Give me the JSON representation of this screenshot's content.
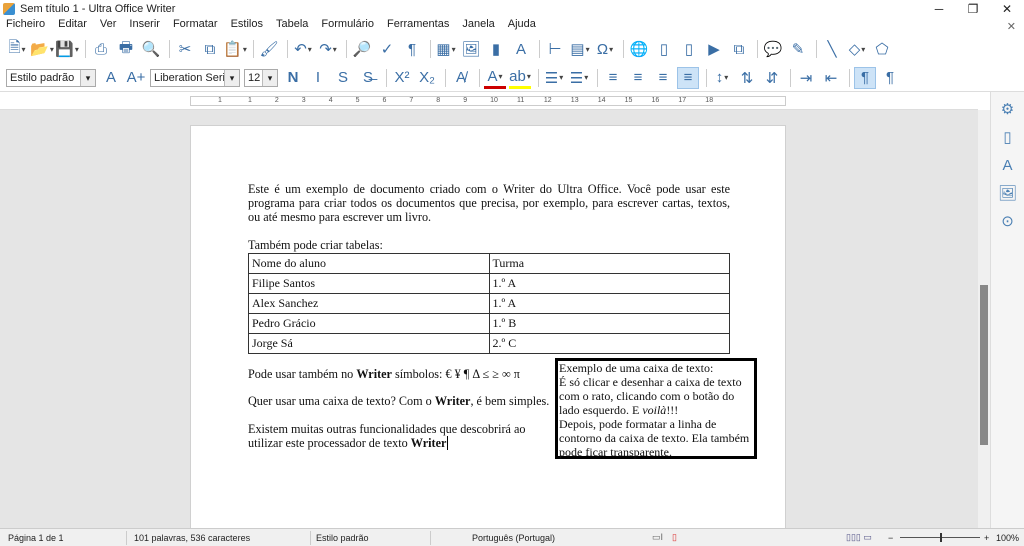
{
  "window": {
    "title": "Sem título 1 - Ultra Office Writer"
  },
  "menu": [
    "Ficheiro",
    "Editar",
    "Ver",
    "Inserir",
    "Formatar",
    "Estilos",
    "Tabela",
    "Formulário",
    "Ferramentas",
    "Janela",
    "Ajuda"
  ],
  "toolbar1": [
    "new-document-icon",
    "open-folder-icon",
    "save-icon",
    "|",
    "export-pdf-icon",
    "print-icon",
    "print-preview-icon",
    "|",
    "cut-icon",
    "copy-icon",
    "paste-icon",
    "|",
    "clone-formatting-icon",
    "|",
    "undo-icon",
    "redo-icon",
    "|",
    "find-replace-icon",
    "spellcheck-icon",
    "formatting-marks-icon",
    "|",
    "insert-table-icon",
    "insert-image-icon",
    "insert-chart-icon",
    "insert-textbox-icon",
    "|",
    "page-break-icon",
    "insert-field-icon",
    "special-character-icon",
    "|",
    "hyperlink-icon",
    "footnote-icon",
    "endnote-icon",
    "bookmark-icon",
    "cross-reference-icon",
    "|",
    "comment-icon",
    "track-changes-icon",
    "|",
    "line-icon",
    "basic-shapes-icon",
    "shapes-icon"
  ],
  "toolbar2": {
    "paragraph_style": "Estilo padrão",
    "font_name": "Liberation Serif",
    "font_size": "12",
    "icons": [
      "update-style-icon",
      "new-style-icon",
      "|",
      "bold-icon",
      "italic-icon",
      "underline-icon",
      "strikethrough-icon",
      "|",
      "superscript-icon",
      "subscript-icon",
      "|",
      "clear-formatting-icon",
      "|",
      "font-color-icon",
      "highlight-icon",
      "|",
      "bullet-list-icon",
      "numbered-list-icon",
      "|",
      "align-left-icon",
      "align-center-icon",
      "align-right-icon",
      "justify-icon",
      "|",
      "line-spacing-icon",
      "increase-paragraph-spacing-icon",
      "decrease-paragraph-spacing-icon",
      "|",
      "increase-indent-icon",
      "decrease-indent-icon",
      "|",
      "ltr-icon",
      "rtl-icon"
    ]
  },
  "ruler": [
    "1",
    "1",
    "2",
    "3",
    "4",
    "5",
    "6",
    "7",
    "8",
    "9",
    "10",
    "11",
    "12",
    "13",
    "14",
    "15",
    "16",
    "17",
    "18"
  ],
  "document": {
    "para1": "Este é um exemplo de documento criado com o Writer do Ultra Office. Você pode usar este programa para criar todos os documentos que precisa, por exemplo, para escrever cartas, textos, ou até mesmo para escrever um livro.",
    "para2": "Também pode criar tabelas:",
    "table": {
      "headers": [
        "Nome do aluno",
        "Turma"
      ],
      "rows": [
        [
          "Filipe Santos",
          "1.º A"
        ],
        [
          "Alex Sanchez",
          "1.º A"
        ],
        [
          "Pedro Grácio",
          "1.º B"
        ],
        [
          "Jorge Sá",
          "2.º C"
        ]
      ]
    },
    "para3_a": "Pode usar também no ",
    "para3_b": "Writer",
    "para3_c": " símbolos: € ¥ ¶ Δ ≤ ≥ ∞ π",
    "para4_a": "Quer usar uma caixa de texto? Com o ",
    "para4_b": "Writer",
    "para4_c": ", é bem simples.",
    "para5_a": "Existem muitas outras funcionalidades que descobrirá ao utilizar este processador de texto ",
    "para5_b": "Writer",
    "textbox": {
      "l1": "Exemplo de uma caixa de texto:",
      "l2": "É só clicar e desenhar a caixa de texto com o rato, clicando com o botão do lado esquerdo. E ",
      "l2_italic": "voilà",
      "l2_end": "!!!",
      "l3": "Depois, pode formatar a linha de contorno da caixa de texto. Ela também pode ficar transparente."
    }
  },
  "sidebar": [
    "properties-icon",
    "page-icon",
    "styles-icon",
    "gallery-icon",
    "navigator-icon"
  ],
  "status": {
    "page": "Página 1 de 1",
    "words": "101 palavras, 536 caracteres",
    "style": "Estilo padrão",
    "language": "Português (Portugal)",
    "zoom": "100%",
    "zoom_level": 100
  }
}
